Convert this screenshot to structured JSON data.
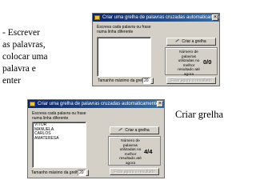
{
  "notes": {
    "left_text": "- Escrever\nas palavras,\ncolocar uma\npalavra e\nenter",
    "right_text": "Criar grelha"
  },
  "window_title": "Criar uma grelha de palavras cruzadas automaticamente",
  "instructions": "Escreva cada palavra ou frase numa linha diferente",
  "create_button_label": "Criar a grelha",
  "stats_label": "Número de palavras utilizadas no melhor resultado até agora",
  "disabled_button_label": "Fixar agora o resultado",
  "size_label": "Tamanho máximo da grelha:",
  "size_value": "20",
  "window1": {
    "score": "0/0"
  },
  "window2": {
    "words": [
      "VITOR",
      "MANUELA",
      "CARLOS",
      "AMATERESA"
    ],
    "score": "4/4"
  }
}
